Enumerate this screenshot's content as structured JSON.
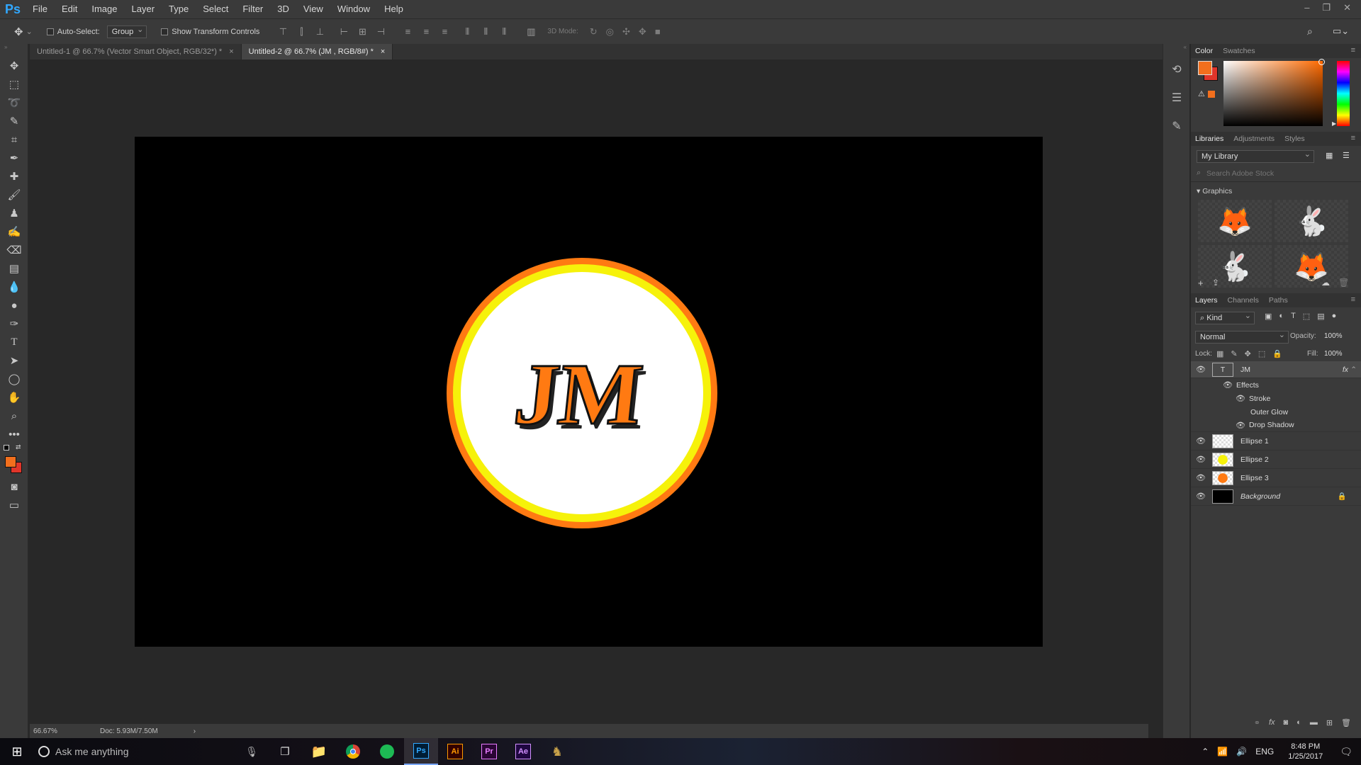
{
  "app": {
    "logo": "Ps",
    "menu": [
      "File",
      "Edit",
      "Image",
      "Layer",
      "Type",
      "Select",
      "Filter",
      "3D",
      "View",
      "Window",
      "Help"
    ]
  },
  "options_bar": {
    "auto_select_label": "Auto-Select:",
    "auto_select_value": "Group",
    "transform_label": "Show Transform Controls",
    "mode3d_label": "3D Mode:"
  },
  "tabs": [
    {
      "label": "Untitled-1 @ 66.7% (Vector Smart Object, RGB/32*) *",
      "close": "×"
    },
    {
      "label": "Untitled-2 @ 66.7% (JM , RGB/8#) *",
      "close": "×"
    }
  ],
  "canvas": {
    "logo_text": "JM",
    "colors": {
      "orange": "#ff7a12",
      "yellow": "#f6f20a",
      "text_fill": "#ff7a12"
    }
  },
  "status": {
    "zoom": "66.67%",
    "doc_size": "Doc: 5.93M/7.50M",
    "arrow": "›"
  },
  "color_panel": {
    "tabs": [
      "Color",
      "Swatches"
    ],
    "foreground": "#f26f1d",
    "background": "#e0352a"
  },
  "libraries_panel": {
    "tabs": [
      "Libraries",
      "Adjustments",
      "Styles"
    ],
    "library_select": "My Library",
    "search_placeholder": "Search Adobe Stock",
    "section": "Graphics"
  },
  "layers_panel": {
    "tabs": [
      "Layers",
      "Channels",
      "Paths"
    ],
    "filter_kind": "Kind",
    "blend_mode": "Normal",
    "opacity_label": "Opacity:",
    "opacity_value": "100%",
    "lock_label": "Lock:",
    "fill_label": "Fill:",
    "fill_value": "100%",
    "text_layer": "JM",
    "effects_label": "Effects",
    "effects": [
      "Stroke",
      "Outer Glow",
      "Drop Shadow"
    ],
    "layers": [
      "Ellipse 1",
      "Ellipse 2",
      "Ellipse 3"
    ],
    "background_layer": "Background"
  },
  "taskbar": {
    "search_placeholder": "Ask me anything",
    "lang": "ENG",
    "time": "8:48 PM",
    "date": "1/25/2017",
    "apps": [
      "Ps",
      "Ai",
      "Pr",
      "Ae"
    ]
  }
}
